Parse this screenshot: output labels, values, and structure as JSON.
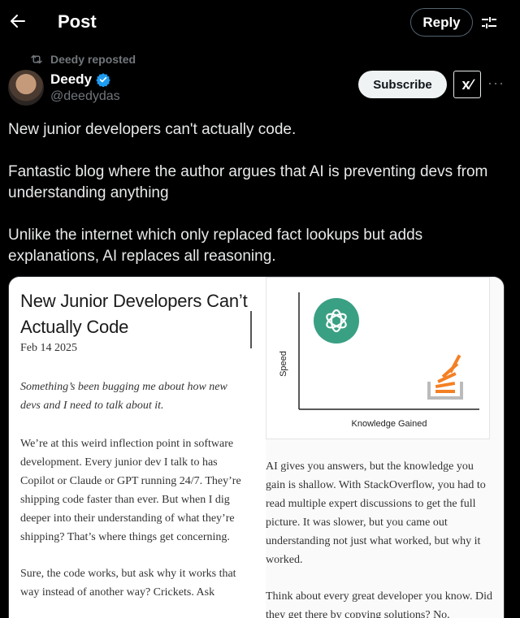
{
  "header": {
    "title": "Post",
    "reply_label": "Reply"
  },
  "icons": {
    "back": "arrow-left-icon",
    "filter": "sliders-icon",
    "repost": "repost-icon",
    "verified": "verified-badge-icon",
    "more": "more-icon"
  },
  "post": {
    "reposted_by": "Deedy reposted",
    "author_name": "Deedy",
    "author_handle": "@deedydas",
    "subscribe_label": "Subscribe",
    "xai_label": "x∕",
    "more_label": "···",
    "text": [
      "New junior developers can't actually code.",
      "Fantastic blog where the author argues that AI is preventing devs from understanding anything",
      "Unlike the internet which only replaced fact lookups but adds explanations, AI replaces all reasoning."
    ]
  },
  "article": {
    "title": "New Junior Developers Can’t Actually Code",
    "date": "Feb 14 2025",
    "lede": "Something’s been bugging me about how new devs and I need to talk about it.",
    "body": [
      "We’re at this weird inflection point in software development. Every junior dev I talk to has Copilot or Claude or GPT running 24/7. They’re shipping code faster than ever. But when I dig deeper into their understanding of what they’re shipping? That’s where things get concerning.",
      "Sure, the code works, but ask why it works that way instead of another way? Crickets. Ask"
    ],
    "right_body": [
      "AI gives you answers, but the knowledge you gain is shallow. With StackOverflow, you had to read multiple expert discussions to get the full picture. It was slower, but you came out understanding not just what worked, but why it worked.",
      "Think about every great developer you know. Did they get there by copying solutions? No."
    ]
  },
  "diagram": {
    "ylabel": "Speed",
    "xlabel": "Knowledge Gained",
    "colors": {
      "openai": "#3aa083",
      "stack_orange": "#f48024",
      "stack_gray": "#bcbbbb"
    }
  }
}
